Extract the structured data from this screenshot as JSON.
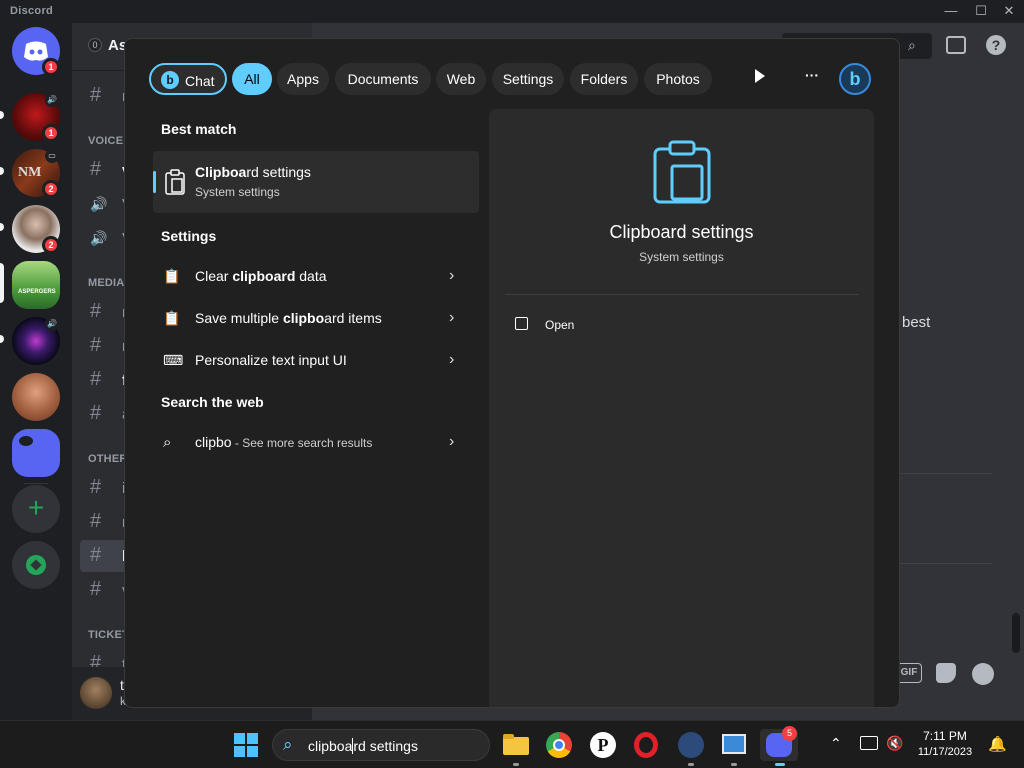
{
  "app": {
    "title": "Discord"
  },
  "window_controls": {
    "minimize": "—",
    "maximize": "☐",
    "close": "✕"
  },
  "rail": {
    "servers": [
      {
        "name": "discord-home",
        "badge": "1",
        "color": "#5865f2"
      },
      {
        "name": "server-red",
        "badge": "1",
        "color": "#7a1010"
      },
      {
        "name": "server-nm",
        "badge": "2",
        "color": "#5a2a1a"
      },
      {
        "name": "server-face",
        "badge": "2",
        "color": "#9a9a9a"
      },
      {
        "name": "server-asperger",
        "badge": "",
        "color": "#5aa84a"
      },
      {
        "name": "server-crystal",
        "badge": "",
        "color": "#2a1a4a"
      },
      {
        "name": "server-bald",
        "badge": "",
        "color": "#b07a5a"
      },
      {
        "name": "server-purple",
        "badge": "",
        "color": "#5865f2"
      }
    ],
    "add_label": "+",
    "explore_label": "✦"
  },
  "channels": {
    "guild_badge": "0",
    "guild_name": "As",
    "items": [
      {
        "kind": "channel",
        "icon": "#",
        "name": "ru",
        "top": 0
      },
      {
        "kind": "category",
        "name": "VOICE"
      },
      {
        "kind": "channel",
        "icon": "#",
        "name": "vo"
      },
      {
        "kind": "voice",
        "icon": "🔊",
        "name": "V"
      },
      {
        "kind": "voice",
        "icon": "🔊",
        "name": "V"
      },
      {
        "kind": "category",
        "name": "MEDIA"
      },
      {
        "kind": "channel",
        "icon": "#",
        "name": "m"
      },
      {
        "kind": "channel",
        "icon": "#",
        "name": "n"
      },
      {
        "kind": "channel",
        "icon": "#",
        "name": "fa"
      },
      {
        "kind": "channel",
        "icon": "#",
        "name": "ar"
      },
      {
        "kind": "category",
        "name": "OTHER"
      },
      {
        "kind": "channel",
        "icon": "#",
        "name": "in"
      },
      {
        "kind": "channel",
        "icon": "#",
        "name": "ro"
      },
      {
        "kind": "channel",
        "icon": "#",
        "name": "be"
      },
      {
        "kind": "channel",
        "icon": "#",
        "name": "ve"
      },
      {
        "kind": "category",
        "name": "TICKET"
      },
      {
        "kind": "channel",
        "icon": "#",
        "name": "ti"
      }
    ],
    "user": {
      "name": "t",
      "sub": "k"
    }
  },
  "chat": {
    "visible_text": "best",
    "gif_label": "GIF"
  },
  "search": {
    "filters": [
      "Chat",
      "All",
      "Apps",
      "Documents",
      "Web",
      "Settings",
      "Folders",
      "Photos"
    ],
    "more_label": "···",
    "best_match_heading": "Best match",
    "best_match": {
      "title_bold": "Clipboa",
      "title_rest": "rd settings",
      "subtitle": "System settings"
    },
    "settings_heading": "Settings",
    "settings_items": [
      {
        "pre": "Clear ",
        "bold": "clipboard",
        "post": " data"
      },
      {
        "pre": "Save multiple ",
        "bold": "clipbo",
        "post": "ard items"
      },
      {
        "pre": "Personalize text input UI",
        "bold": "",
        "post": ""
      }
    ],
    "web_heading": "Search the web",
    "web_item": {
      "query": "clipbo",
      "suffix": " - See more search results"
    },
    "preview": {
      "title": "Clipboard settings",
      "subtitle": "System settings",
      "action": "Open"
    }
  },
  "taskbar": {
    "search_text_pre": "clipboa",
    "search_text_post": "rd settings",
    "discord_badge": "5",
    "time": "7:11 PM",
    "date": "11/17/2023"
  },
  "colors": {
    "accent": "#60cdff",
    "discord_red": "#f23f43",
    "discord_green": "#23a55a"
  }
}
